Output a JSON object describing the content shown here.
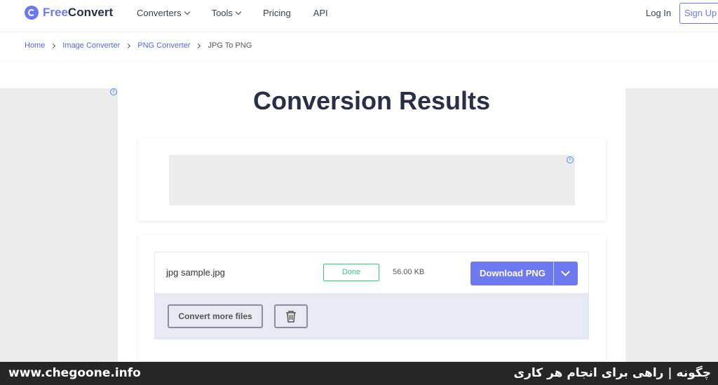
{
  "header": {
    "logo_prefix": "Free",
    "logo_suffix": "Convert",
    "nav": [
      "Converters",
      "Tools",
      "Pricing",
      "API"
    ],
    "login_label": "Log In",
    "signup_label": "Sign Up"
  },
  "breadcrumb": [
    "Home",
    "Image Converter",
    "PNG Converter",
    "JPG To PNG"
  ],
  "main": {
    "title": "Conversion Results",
    "info_glyph": "i"
  },
  "file": {
    "name": "jpg sample.jpg",
    "status": "Done",
    "size": "56.00 KB",
    "download_label": "Download PNG"
  },
  "actions": {
    "convert_more_label": "Convert more files"
  },
  "footer": {
    "left_text": "www.chegoone.info",
    "right_text": "چگونه | راهی برای انجام هر کاری"
  },
  "colors": {
    "accent": "#6e79f0",
    "status_done": "#3cc77f",
    "footer_bg": "#262626"
  }
}
